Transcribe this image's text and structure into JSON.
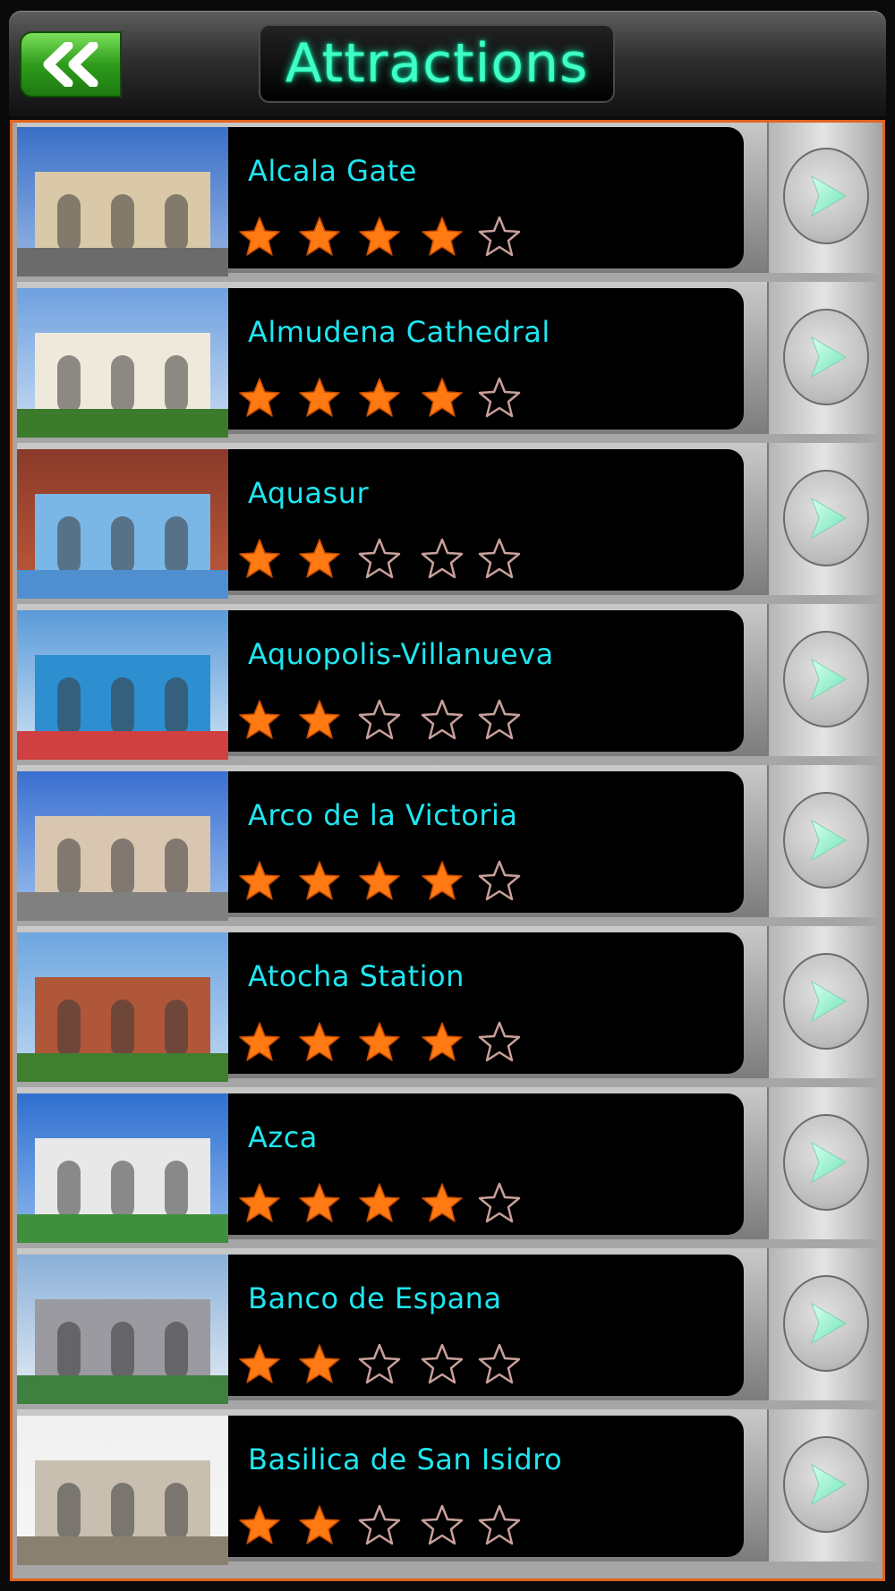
{
  "header": {
    "title": "Attractions",
    "back_icon": "double-chevron-left-icon"
  },
  "colors": {
    "accent": "#e0641e",
    "title": "#3fffc8",
    "item_text": "#1fe6f0",
    "star_filled": "#ff7a12",
    "back_button": "#2e9c1c"
  },
  "attractions": [
    {
      "name": "Alcala Gate",
      "rating": 4,
      "photo": "alcala-gate-photo"
    },
    {
      "name": "Almudena Cathedral",
      "rating": 4,
      "photo": "almudena-cathedral-photo"
    },
    {
      "name": "Aquasur",
      "rating": 2,
      "photo": "aquasur-photo"
    },
    {
      "name": "Aquopolis-Villanueva",
      "rating": 2,
      "photo": "aquopolis-villanueva-photo"
    },
    {
      "name": "Arco de la Victoria",
      "rating": 4,
      "photo": "arco-de-la-victoria-photo"
    },
    {
      "name": "Atocha Station",
      "rating": 4,
      "photo": "atocha-station-photo"
    },
    {
      "name": "Azca",
      "rating": 4,
      "photo": "azca-photo"
    },
    {
      "name": "Banco de Espana",
      "rating": 2,
      "photo": "banco-de-espana-photo"
    },
    {
      "name": "Basilica de San Isidro",
      "rating": 2,
      "photo": "basilica-de-san-isidro-photo"
    }
  ]
}
